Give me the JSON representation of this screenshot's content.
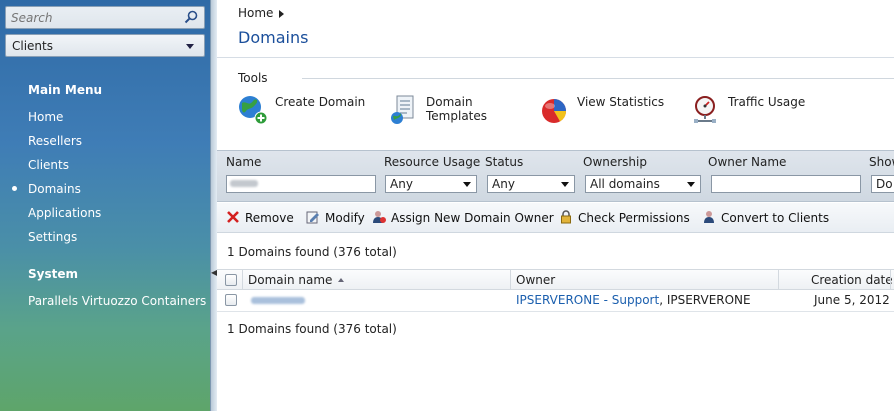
{
  "sidebar": {
    "search_placeholder": "Search",
    "context_select": "Clients",
    "main_menu_title": "Main Menu",
    "main_menu": [
      "Home",
      "Resellers",
      "Clients",
      "Domains",
      "Applications",
      "Settings"
    ],
    "active_item": "Domains",
    "system_title": "System",
    "system_menu": [
      "Parallels Virtuozzo Containers"
    ]
  },
  "breadcrumb": {
    "home": "Home"
  },
  "page_title": "Domains",
  "tools": {
    "label": "Tools",
    "items": [
      {
        "label": "Create Domain",
        "icon": "create-domain-icon"
      },
      {
        "label": "Domain\nTemplates",
        "line1": "Domain",
        "line2": "Templates",
        "icon": "domain-templates-icon"
      },
      {
        "label": "View Statistics",
        "icon": "view-statistics-icon"
      },
      {
        "label": "Traffic Usage",
        "icon": "traffic-usage-icon"
      }
    ]
  },
  "filters": {
    "name_label": "Name",
    "resource_usage_label": "Resource Usage",
    "resource_usage_value": "Any",
    "status_label": "Status",
    "status_value": "Any",
    "ownership_label": "Ownership",
    "ownership_value": "All domains",
    "owner_name_label": "Owner Name",
    "show_label": "Show",
    "show_value": "Do"
  },
  "actions": {
    "remove": "Remove",
    "modify": "Modify",
    "assign_owner": "Assign New Domain Owner",
    "check_permissions": "Check Permissions",
    "convert_clients": "Convert to Clients"
  },
  "summary": "1 Domains found (376 total)",
  "table": {
    "columns": {
      "domain": "Domain name",
      "owner": "Owner",
      "created": "Creation date"
    },
    "rows": [
      {
        "owner_link": "IPSERVERONE - Support",
        "owner_sep": ",",
        "owner_rest": " IPSERVERONE",
        "created": "June 5, 2012"
      }
    ]
  },
  "colors": {
    "accent": "#1b4f9b",
    "link": "#1b5fae"
  }
}
